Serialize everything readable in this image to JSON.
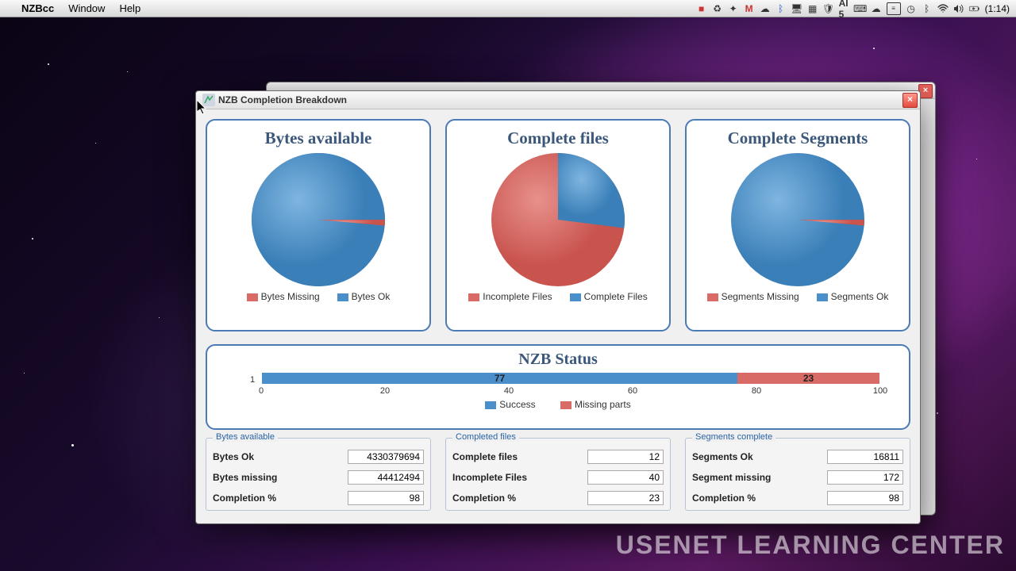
{
  "menubar": {
    "app": "NZBcc",
    "menus": [
      "Window",
      "Help"
    ],
    "clock": "1:14"
  },
  "window": {
    "title": "NZB Completion Breakdown"
  },
  "colors": {
    "blue": "#4a8fc9",
    "red": "#d96b66",
    "card_border": "#4a7bb5",
    "title_text": "#3b577a"
  },
  "chart_data": [
    {
      "type": "pie",
      "title": "Bytes available",
      "series": [
        {
          "name": "Bytes Missing",
          "value": 2,
          "color": "#d96b66"
        },
        {
          "name": "Bytes Ok",
          "value": 98,
          "color": "#4a8fc9"
        }
      ]
    },
    {
      "type": "pie",
      "title": "Complete files",
      "series": [
        {
          "name": "Incomplete Files",
          "value": 77,
          "color": "#d96b66"
        },
        {
          "name": "Complete Files",
          "value": 23,
          "color": "#4a8fc9"
        }
      ]
    },
    {
      "type": "pie",
      "title": "Complete Segments",
      "series": [
        {
          "name": "Segments Missing",
          "value": 2,
          "color": "#d96b66"
        },
        {
          "name": "Segments Ok",
          "value": 98,
          "color": "#4a8fc9"
        }
      ]
    },
    {
      "type": "bar",
      "title": "NZB Status",
      "orientation": "horizontal-stacked",
      "categories": [
        "1"
      ],
      "series": [
        {
          "name": "Success",
          "values": [
            77
          ],
          "color": "#4a8fc9"
        },
        {
          "name": "Missing parts",
          "values": [
            23
          ],
          "color": "#d96b66"
        }
      ],
      "xlim": [
        0,
        100
      ],
      "xticks": [
        0,
        20,
        40,
        60,
        80,
        100
      ],
      "xlabel": "",
      "ylabel": ""
    }
  ],
  "status_bar": {
    "title": "NZB Status",
    "success_pct": 77,
    "missing_pct": 23,
    "legend": {
      "success": "Success",
      "missing": "Missing parts"
    },
    "ticks": [
      0,
      20,
      40,
      60,
      80,
      100
    ],
    "ylabel": "1"
  },
  "stats": {
    "bytes": {
      "group": "Bytes available",
      "rows": [
        {
          "label": "Bytes Ok",
          "value": "4330379694"
        },
        {
          "label": "Bytes missing",
          "value": "44412494"
        },
        {
          "label": "Completion %",
          "value": "98"
        }
      ]
    },
    "files": {
      "group": "Completed files",
      "rows": [
        {
          "label": "Complete files",
          "value": "12"
        },
        {
          "label": "Incomplete Files",
          "value": "40"
        },
        {
          "label": "Completion %",
          "value": "23"
        }
      ]
    },
    "segments": {
      "group": "Segments complete",
      "rows": [
        {
          "label": "Segments Ok",
          "value": "16811"
        },
        {
          "label": "Segment missing",
          "value": "172"
        },
        {
          "label": "Completion %",
          "value": "98"
        }
      ]
    }
  },
  "watermark": "USENET LEARNING CENTER"
}
